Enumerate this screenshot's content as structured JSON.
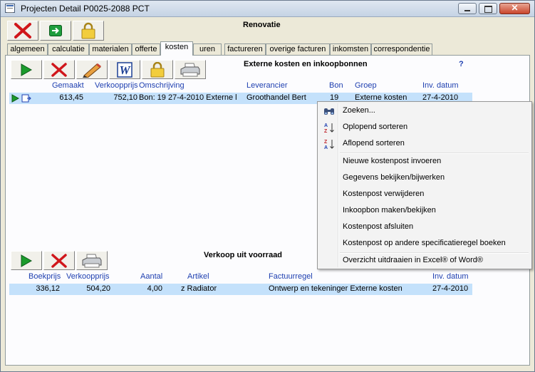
{
  "window": {
    "title": "Projecten Detail   P0025-2088   PCT",
    "project_name": "Renovatie"
  },
  "tabs": [
    "algemeen",
    "calculatie",
    "materialen",
    "offerte",
    "kosten",
    "uren",
    "factureren",
    "overige facturen",
    "inkomsten",
    "correspondentie"
  ],
  "active_tab": "kosten",
  "section1": {
    "heading": "Externe kosten en inkoopbonnen",
    "help": "?",
    "columns": {
      "gemaakt": "Gemaakt",
      "verkoopprijs": "Verkoopprijs",
      "omschrijving": "Omschrijving",
      "leverancier": "Leverancier",
      "bon": "Bon",
      "groep": "Groep",
      "inv_datum": "Inv. datum"
    },
    "rows": [
      {
        "gemaakt": "613,45",
        "verkoopprijs": "752,10",
        "omschrijving": "Bon: 19 27-4-2010 Externe l",
        "leverancier": "Groothandel Bert",
        "bon": "19",
        "groep": "Externe kosten",
        "inv_datum": "27-4-2010"
      }
    ]
  },
  "section2": {
    "heading": "Verkoop uit voorraad",
    "columns": {
      "boekprijs": "Boekprijs",
      "verkoopprijs": "Verkoopprijs",
      "aantal": "Aantal",
      "artikel": "Artikel",
      "factuurregel": "Factuurregel",
      "inv_datum": "Inv. datum"
    },
    "rows": [
      {
        "boekprijs": "336,12",
        "verkoopprijs": "504,20",
        "aantal": "4,00",
        "artikel": "z Radiator",
        "factuurregel": "Ontwerp en tekeninger Externe kosten",
        "inv_datum": "27-4-2010"
      }
    ]
  },
  "context_menu": {
    "items": [
      {
        "label": "Zoeken...",
        "icon": "binoculars-icon"
      },
      {
        "label": "Oplopend sorteren",
        "icon": "sort-ascending-icon"
      },
      {
        "label": "Aflopend sorteren",
        "icon": "sort-descending-icon"
      },
      {
        "label": "Nieuwe kostenpost invoeren"
      },
      {
        "label": "Gegevens bekijken/bijwerken"
      },
      {
        "label": "Kostenpost verwijderen"
      },
      {
        "label": "Inkoopbon maken/bekijken"
      },
      {
        "label": "Kostenpost afsluiten"
      },
      {
        "label": "Kostenpost op andere specificatieregel boeken"
      },
      {
        "label": "Overzicht uitdraaien in Excel® of Word®"
      }
    ]
  },
  "icons": {
    "toolbar_main": [
      "delete-icon",
      "go-icon",
      "lock-icon"
    ],
    "toolbar_section1": [
      "play-icon",
      "delete-icon",
      "edit-pencil-icon",
      "word-icon",
      "lock-icon",
      "printer-icon"
    ],
    "toolbar_section2": [
      "play-icon",
      "delete-icon",
      "printer-icon"
    ]
  },
  "colors": {
    "accent": "#1e3fb0",
    "selected_row": "#c4e1fb"
  }
}
